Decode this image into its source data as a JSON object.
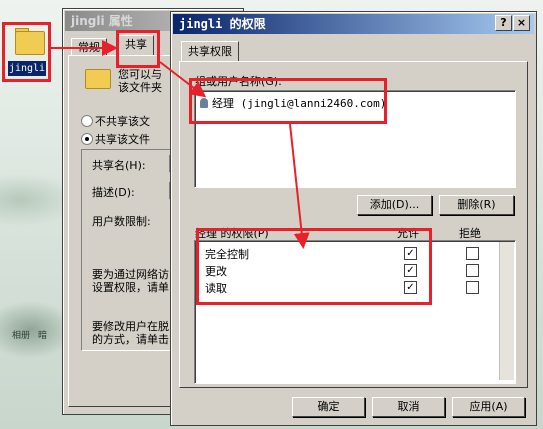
{
  "desktop": {
    "folder_label": "jingli",
    "wall_labels": [
      "相册",
      "暗"
    ]
  },
  "properties_window": {
    "title": "jingli 属性",
    "tabs": [
      "常规",
      "共享"
    ],
    "desc_lines": [
      "您可以与",
      "该文件夹"
    ],
    "radio_no_share": "不共享该文",
    "radio_share": "共享该文件",
    "share_name_label": "共享名(H):",
    "description_label": "描述(D):",
    "user_limit_label": "用户数限制:",
    "note1_lines": [
      "要为通过网络访",
      "设置权限，请单"
    ],
    "note2_lines": [
      "要修改用户在脱",
      "的方式，请单击"
    ]
  },
  "permissions_window": {
    "title": "jingli 的权限",
    "help_btn": "?",
    "close_btn": "×",
    "tab_label": "共享权限",
    "group_label": "组或用户名称(G):",
    "user_entry": "经理 (jingli@lanni2460.com)",
    "add_button": "添加(D)...",
    "remove_button": "删除(R)",
    "perm_header": "经理 的权限(P)",
    "allow_header": "允许",
    "deny_header": "拒绝",
    "permissions": [
      {
        "name": "完全控制",
        "allow": true,
        "deny": false
      },
      {
        "name": "更改",
        "allow": true,
        "deny": false
      },
      {
        "name": "读取",
        "allow": true,
        "deny": false
      }
    ],
    "check_mark": "✓",
    "ok_button": "确定",
    "cancel_button": "取消",
    "apply_button": "应用(A)"
  },
  "colors": {
    "highlight_box": "#e8202a",
    "active_title": "#0a246a",
    "window_face": "#d4d0c8"
  }
}
